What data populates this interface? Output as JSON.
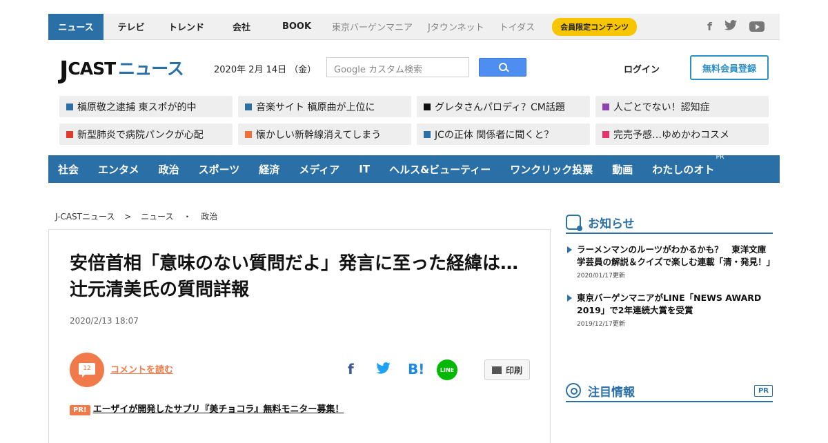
{
  "topnav": {
    "tabs": [
      "ニュース",
      "テレビ",
      "トレンド",
      "会社",
      "BOOK"
    ],
    "sub_links": [
      "東京バーゲンマニア",
      "Jタウンネット",
      "トイダス"
    ],
    "badge": "会員限定コンテンツ",
    "social": [
      "facebook-icon",
      "twitter-icon",
      "youtube-icon"
    ]
  },
  "header": {
    "logo_j": "J",
    "logo_cast": "CAST",
    "logo_news": "ニュース",
    "date": "2020年 2月 14日 （金）",
    "search_placeholder": "Google カスタム検索",
    "login": "ログイン",
    "register": "無料会員登録"
  },
  "trends": [
    {
      "label": "槇原敬之逮捕 東スポが的中",
      "color": "#2a6fa5"
    },
    {
      "label": "音楽サイト 槇原曲が上位に",
      "color": "#2a6fa5"
    },
    {
      "label": "グレタさんパロディ？CM話題",
      "color": "#111111"
    },
    {
      "label": "人ごとでない！認知症",
      "color": "#8e44ad"
    },
    {
      "label": "新型肺炎で病院パンクが心配",
      "color": "#e03a2a"
    },
    {
      "label": "懐かしい新幹線消えてしまう",
      "color": "#f0703a"
    },
    {
      "label": "JCの正体 関係者に聞くと？",
      "color": "#2a6fa5"
    },
    {
      "label": "完売予感…ゆめかわコスメ",
      "color": "#e8306a"
    }
  ],
  "categories": [
    "社会",
    "エンタメ",
    "政治",
    "スポーツ",
    "経済",
    "メディア",
    "IT",
    "ヘルス&ビューティー",
    "ワンクリック投票",
    "動画",
    "わたしのオト"
  ],
  "category_pr": "PR",
  "breadcrumb": [
    "J-CASTニュース",
    ">",
    "ニュース",
    "・",
    "政治"
  ],
  "article": {
    "title": "安倍首相「意味のない質問だよ」発言に至った経緯は…　辻元清美氏の質問詳報",
    "time": "2020/2/13 18:07",
    "comment_count": "12",
    "comment_link": "コメントを読む",
    "share": {
      "fb": "f",
      "hb": "B!",
      "line": "LINE"
    },
    "print": "印刷",
    "pr_badge": "PR!",
    "pr_text": "エーザイが開発したサプリ『美チョコラ』無料モニター募集！"
  },
  "sidebar": {
    "notice_title": "お知らせ",
    "notices": [
      {
        "text": "ラーメンマンのルーツがわかるかも？　東洋文庫学芸員の解説＆クイズで楽しむ連載「清・発見！」",
        "date": "2020/01/17更新"
      },
      {
        "text": "東京バーゲンマニアがLINE「NEWS AWARD 2019」で2年連続大賞を受賞",
        "date": "2019/12/17更新"
      }
    ],
    "featured_title": "注目情報",
    "featured_pr": "PR"
  }
}
